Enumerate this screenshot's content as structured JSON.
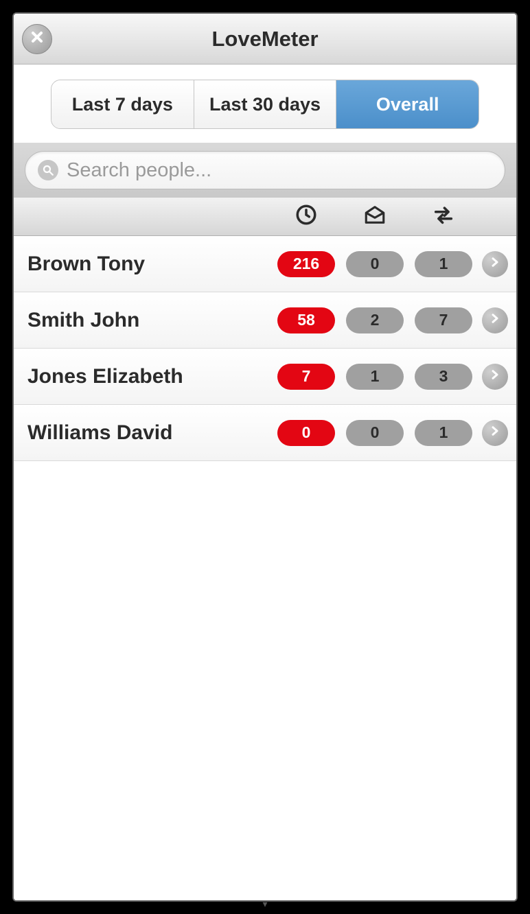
{
  "header": {
    "title": "LoveMeter"
  },
  "segmented": {
    "items": [
      {
        "label": "Last 7 days",
        "active": false
      },
      {
        "label": "Last 30 days",
        "active": false
      },
      {
        "label": "Overall",
        "active": true
      }
    ]
  },
  "search": {
    "placeholder": "Search people...",
    "value": ""
  },
  "rows": [
    {
      "name": "Brown Tony",
      "time": "216",
      "mail": "0",
      "swap": "1"
    },
    {
      "name": "Smith John",
      "time": "58",
      "mail": "2",
      "swap": "7"
    },
    {
      "name": "Jones Elizabeth",
      "time": "7",
      "mail": "1",
      "swap": "3"
    },
    {
      "name": "Williams David",
      "time": "0",
      "mail": "0",
      "swap": "1"
    }
  ]
}
